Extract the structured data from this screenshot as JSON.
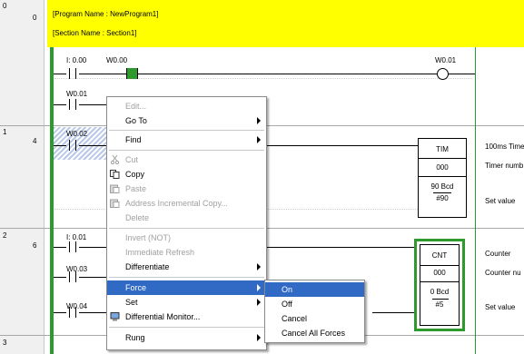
{
  "header": {
    "program_name": "[Program Name : NewProgram1]",
    "section_name": "[Section Name : Section1]"
  },
  "rungs": [
    {
      "number": "0",
      "step": "0"
    },
    {
      "number": "1",
      "step": "4"
    },
    {
      "number": "2",
      "step": "6"
    },
    {
      "number": "3"
    }
  ],
  "operands": {
    "r0_contact1": "I: 0.00",
    "r0_contact2": "W0.00",
    "r0_output": "W0.01",
    "r0_branch": "W0.01",
    "r1_contact": "W0.02",
    "r2_contact1": "I: 0.01",
    "r2_contact2": "W0.03",
    "r2_contact3": "W0.04"
  },
  "timer_block": {
    "name": "TIM",
    "number": "000",
    "set_value_bcd": "90 Bcd",
    "set_value": "#90",
    "comments": [
      "100ms Time",
      "Timer numb",
      "Set value"
    ]
  },
  "counter_block": {
    "name": "CNT",
    "number": "000",
    "set_value_bcd": "0 Bcd",
    "set_value": "#5",
    "comments": [
      "Counter",
      "Counter nu",
      "Set value"
    ]
  },
  "context_menu": {
    "items": [
      {
        "label": "Edit...",
        "disabled": true
      },
      {
        "label": "Go To",
        "submenu": true
      },
      {
        "separator": true
      },
      {
        "label": "Find",
        "submenu": true
      },
      {
        "separator": true
      },
      {
        "label": "Cut",
        "disabled": true,
        "icon": "scissors-icon"
      },
      {
        "label": "Copy",
        "icon": "copy-icon"
      },
      {
        "label": "Paste",
        "disabled": true,
        "icon": "paste-icon"
      },
      {
        "label": "Address Incremental Copy...",
        "disabled": true,
        "icon": "incremental-copy-icon"
      },
      {
        "label": "Delete",
        "disabled": true
      },
      {
        "separator": true
      },
      {
        "label": "Invert (NOT)",
        "disabled": true
      },
      {
        "label": "Immediate Refresh",
        "disabled": true
      },
      {
        "label": "Differentiate",
        "submenu": true
      },
      {
        "separator": true
      },
      {
        "label": "Force",
        "submenu": true,
        "selected": true
      },
      {
        "label": "Set",
        "submenu": true
      },
      {
        "label": "Differential Monitor...",
        "icon": "differential-monitor-icon"
      },
      {
        "separator": true
      },
      {
        "label": "Rung",
        "submenu": true
      }
    ]
  },
  "force_submenu": {
    "items": [
      {
        "label": "On",
        "selected": true
      },
      {
        "label": "Off"
      },
      {
        "label": "Cancel"
      },
      {
        "label": "Cancel All Forces"
      }
    ]
  },
  "colors": {
    "banner": "#ffff00",
    "power_rail": "#2e9a2e",
    "counter_highlight": "#2e9a2e",
    "menu_selection": "#316ac5"
  }
}
